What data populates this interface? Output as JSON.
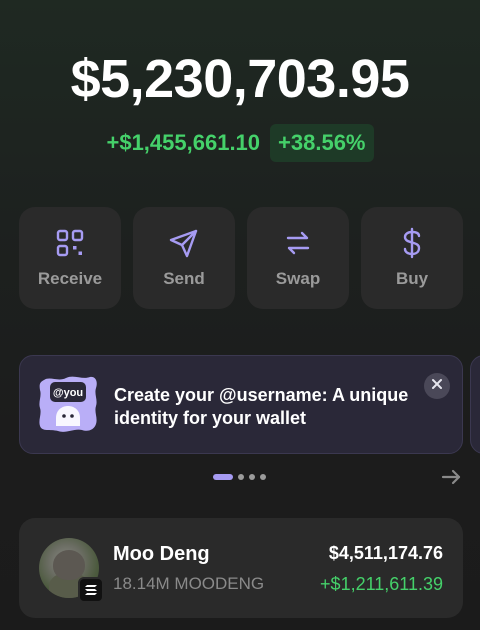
{
  "portfolio": {
    "balance": "$5,230,703.95",
    "change_abs": "+$1,455,661.10",
    "change_pct": "+38.56%"
  },
  "actions": [
    {
      "label": "Receive",
      "icon": "qr-code-icon"
    },
    {
      "label": "Send",
      "icon": "send-icon"
    },
    {
      "label": "Swap",
      "icon": "swap-icon"
    },
    {
      "label": "Buy",
      "icon": "dollar-icon"
    }
  ],
  "banner": {
    "art_tag": "@you",
    "text": "Create your @username: A unique identity for your wallet",
    "close_icon": "close-icon"
  },
  "carousel": {
    "page_count": 4,
    "active_index": 0,
    "next_icon": "arrow-right-icon"
  },
  "tokens": [
    {
      "name": "Moo Deng",
      "amount": "18.14M MOODENG",
      "value": "$4,511,174.76",
      "pnl": "+$1,211,611.39",
      "chain_icon": "solana-icon"
    }
  ],
  "colors": {
    "positive": "#45d16a",
    "accent": "#a69bf2",
    "card": "#2a2a2a",
    "banner": "#2a2838"
  }
}
